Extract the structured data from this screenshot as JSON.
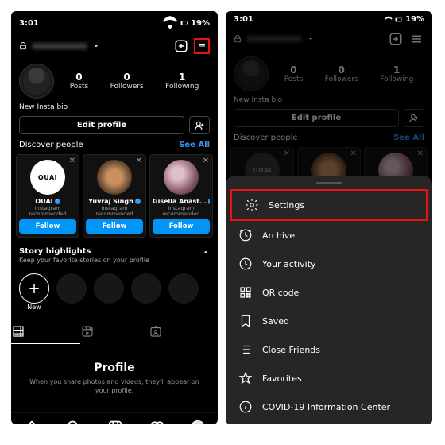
{
  "status": {
    "time": "3:01",
    "battery": "19%"
  },
  "header": {
    "post_icon": "plus",
    "menu_icon": "menu"
  },
  "stats": {
    "posts": {
      "n": "0",
      "l": "Posts"
    },
    "followers": {
      "n": "0",
      "l": "Followers"
    },
    "following": {
      "n": "1",
      "l": "Following"
    }
  },
  "bio": "New Insta bio",
  "edit": {
    "label": "Edit profile"
  },
  "discover": {
    "title": "Discover people",
    "see_all": "See All",
    "cards": [
      {
        "brand": "OUAI",
        "name": "OUAI",
        "sub": "Instagram recommended",
        "follow": "Follow"
      },
      {
        "name": "Yuvraj Singh",
        "sub": "Instagram recommended",
        "follow": "Follow"
      },
      {
        "name": "Gisella Anast...",
        "sub": "Instagram recommended",
        "follow": "Follow"
      }
    ]
  },
  "story": {
    "title": "Story highlights",
    "sub": "Keep your favorite stories on your profile",
    "new": "New"
  },
  "empty": {
    "title": "Profile",
    "text": "When you share photos and videos, they'll appear on your profile."
  },
  "menu": {
    "settings": "Settings",
    "archive": "Archive",
    "activity": "Your activity",
    "qr": "QR code",
    "saved": "Saved",
    "close": "Close Friends",
    "fav": "Favorites",
    "covid": "COVID-19 Information Center"
  }
}
